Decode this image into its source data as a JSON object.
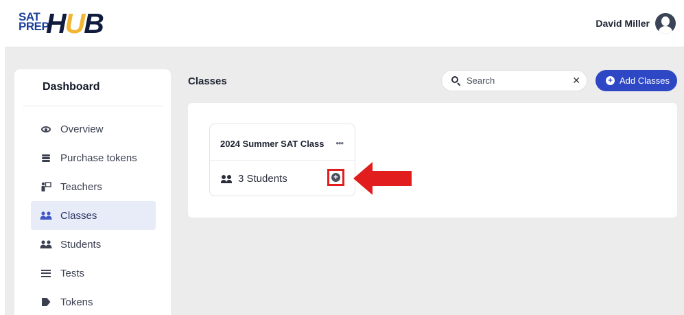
{
  "header": {
    "logo": {
      "line1": "SAT",
      "line2": "PREP",
      "word_start": "H",
      "word_u": "U",
      "word_end": "B"
    },
    "user_name": "David Miller"
  },
  "sidebar": {
    "title": "Dashboard",
    "items": [
      {
        "label": "Overview",
        "icon": "eye-icon",
        "active": false
      },
      {
        "label": "Purchase tokens",
        "icon": "coins-icon",
        "active": false
      },
      {
        "label": "Teachers",
        "icon": "teacher-icon",
        "active": false
      },
      {
        "label": "Classes",
        "icon": "users-icon",
        "active": true
      },
      {
        "label": "Students",
        "icon": "users-icon",
        "active": false
      },
      {
        "label": "Tests",
        "icon": "list-icon",
        "active": false
      },
      {
        "label": "Tokens",
        "icon": "tag-icon",
        "active": false
      }
    ]
  },
  "main": {
    "heading": "Classes",
    "search": {
      "placeholder": "Search",
      "value": ""
    },
    "add_button_label": "Add Classes",
    "class_cards": [
      {
        "title": "2024 Summer SAT Class",
        "menu": "•••",
        "students": "3 Students"
      }
    ]
  },
  "colors": {
    "accent": "#2e47c4",
    "active_bg": "#e8ebf8",
    "highlight_red": "#e11d1d",
    "logo_blue": "#1c3f9c",
    "logo_gold": "#f2b632"
  }
}
